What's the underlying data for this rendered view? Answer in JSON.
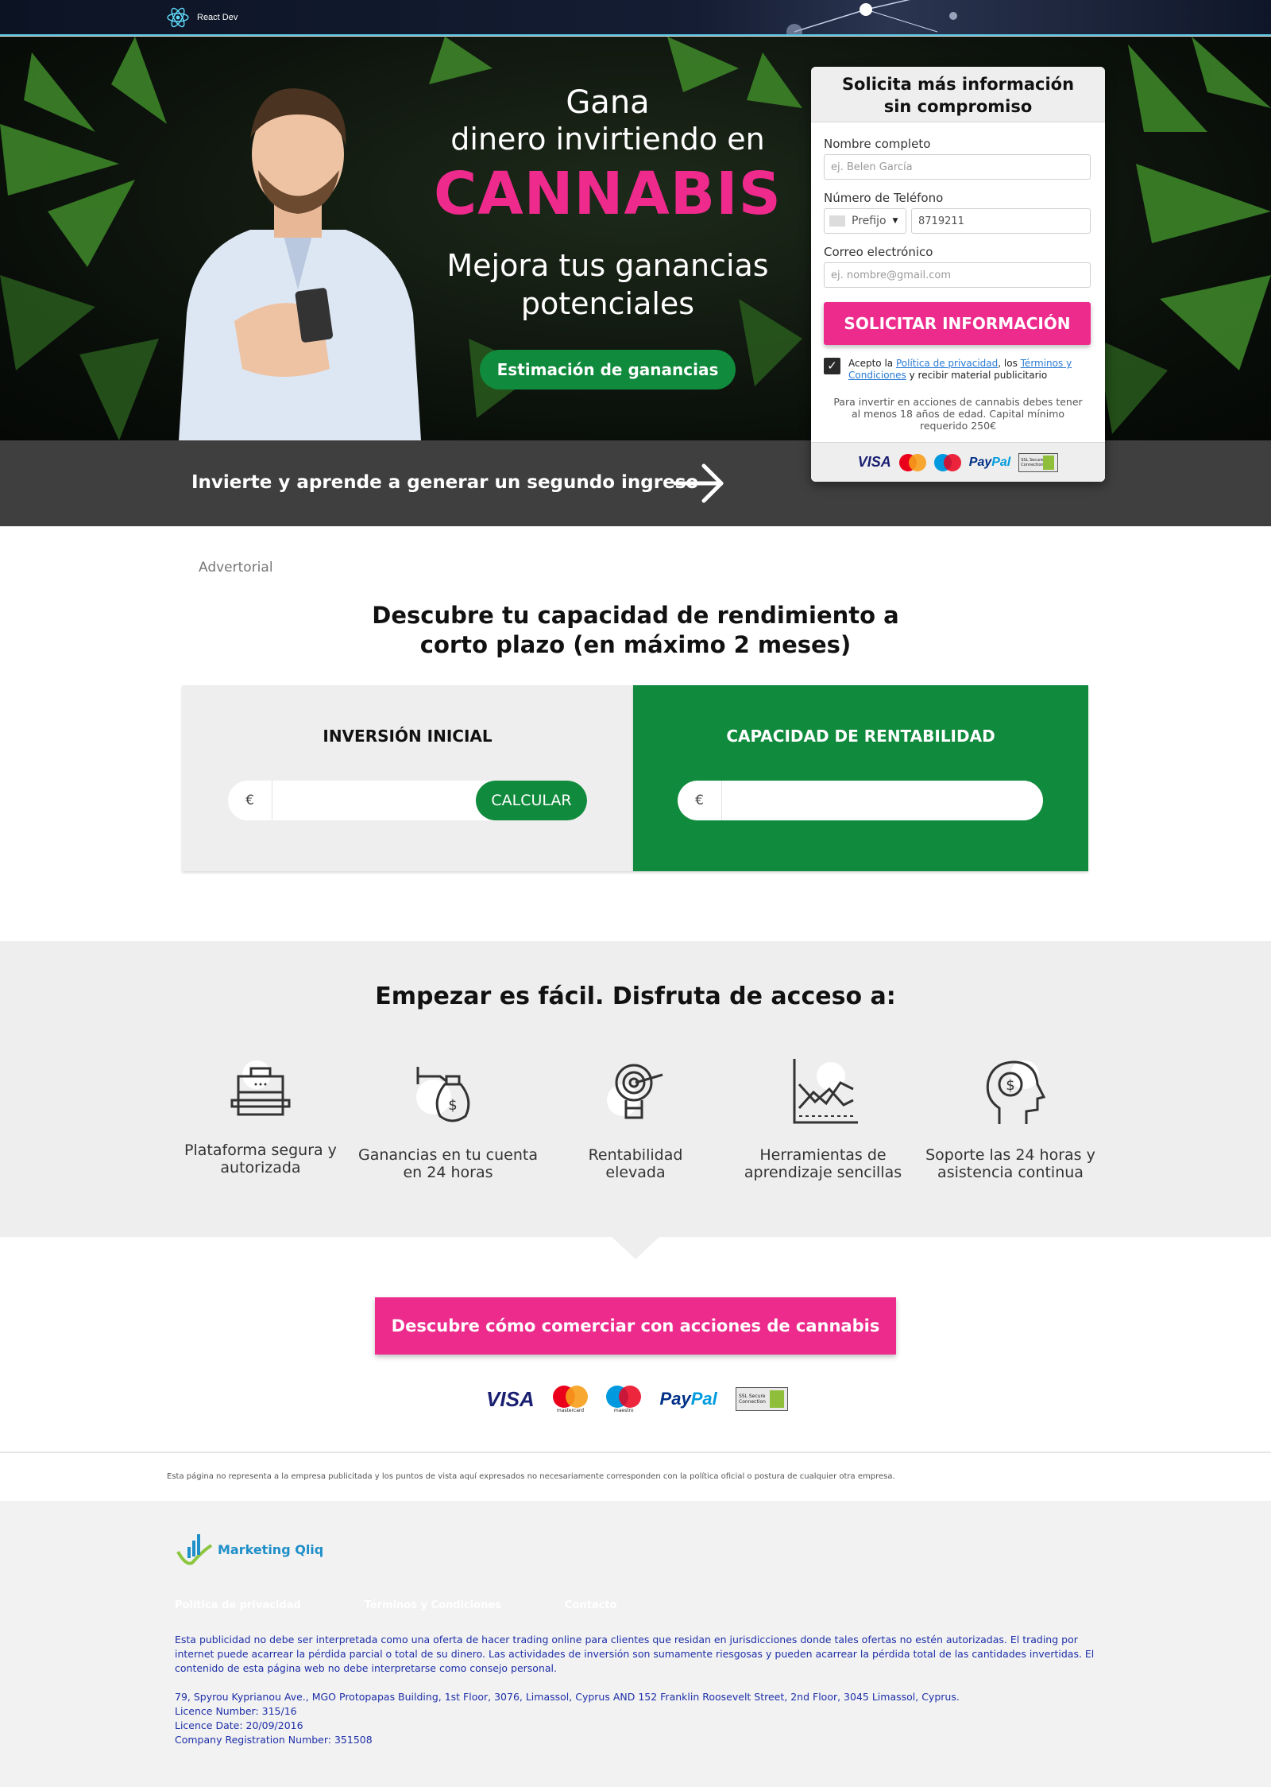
{
  "header": {
    "brand": "React Dev"
  },
  "hero": {
    "line1": "Gana",
    "line2": "dinero invirtiendo en",
    "highlight": "CANNABIS",
    "subline1": "Mejora tus ganancias",
    "subline2": "potenciales",
    "cta": "Estimación de ganancias"
  },
  "band": {
    "text": "Invierte y aprende a generar un segundo ingreso"
  },
  "form": {
    "title_line1": "Solicita más información",
    "title_line2": "sin compromiso",
    "name_label": "Nombre completo",
    "name_placeholder": "ej. Belen García",
    "phone_label": "Número de Teléfono",
    "prefix_label": "Prefijo",
    "phone_value": "8719211",
    "email_label": "Correo electrónico",
    "email_placeholder": "ej. nombre@gmail.com",
    "submit": "SOLICITAR INFORMACIÓN",
    "consent_prefix": "Acepto la ",
    "privacy_link": "Política de privacidad",
    "consent_mid": ", los ",
    "terms_link": "Términos y Condiciones",
    "consent_suffix": " y recibir material publicitario",
    "consent_checked": true,
    "note": "Para invertir en acciones de cannabis debes tener al menos 18 años de edad. Capital mínimo requerido 250€"
  },
  "payments": {
    "visa": "VISA",
    "mastercard": "mastercard",
    "maestro": "maestro",
    "paypal_a": "Pay",
    "paypal_b": "Pal",
    "ssl": "SSL Secure Connection"
  },
  "advertorial": "Advertorial",
  "calculator": {
    "title_line1": "Descubre tu capacidad de rendimiento a",
    "title_line2": "corto plazo (en máximo 2 meses)",
    "left_heading": "INVERSIÓN INICIAL",
    "right_heading": "CAPACIDAD DE RENTABILIDAD",
    "currency": "€",
    "button": "CALCULAR"
  },
  "features": {
    "title": "Empezar es fácil. Disfruta de acceso a:",
    "items": [
      {
        "icon": "briefcase-icon",
        "line1": "Plataforma segura y",
        "line2": "autorizada"
      },
      {
        "icon": "money-bag-hand-icon",
        "line1": "Ganancias en tu cuenta",
        "line2": "en 24 horas"
      },
      {
        "icon": "lightbulb-target-icon",
        "line1": "Rentabilidad",
        "line2": "elevada"
      },
      {
        "icon": "growth-chart-icon",
        "line1": "Herramientas de",
        "line2": "aprendizaje sencillas"
      },
      {
        "icon": "head-dollar-icon",
        "line1": "Soporte las 24 horas y",
        "line2": "asistencia continua"
      }
    ]
  },
  "cta": {
    "label": "Descubre cómo comerciar con acciones de cannabis"
  },
  "disclaimer": "Esta página no representa a la empresa publicitada y los puntos de vista aquí expresados no necesariamente corresponden con la política oficial o postura de cualquier otra empresa.",
  "footer": {
    "logo_text": "Marketing Qliq",
    "links": [
      "Política de privacidad",
      "Términos y Condiciones",
      "Contacto"
    ],
    "warning": "Esta publicidad no debe ser interpretada como una oferta de hacer trading online para clientes que residan en jurisdicciones donde tales ofertas no estén autorizadas. El trading por internet puede acarrear la pérdida parcial o total de su dinero. Las actividades de inversión son sumamente riesgosas y pueden acarrear la pérdida total de las cantidades invertidas. El contenido de esta página web no debe interpretarse como consejo personal.",
    "address": "79, Spyrou Kyprianou Ave., MGO Protopapas Building, 1st Floor, 3076, Limassol, Cyprus AND 152 Franklin Roosevelt Street, 2nd Floor, 3045 Limassol, Cyprus.",
    "licence_number": "Licence Number: 315/16",
    "licence_date": "Licence Date: 20/09/2016",
    "company_reg": "Company Registration Number: 351508"
  },
  "colors": {
    "accent_pink": "#ed2b8d",
    "accent_green": "#108a3c",
    "band_gray": "#3f3f3f",
    "footer_text_blue": "#1d2fa8"
  }
}
